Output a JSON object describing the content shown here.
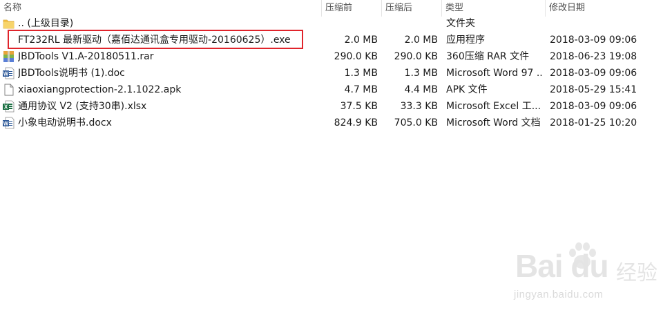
{
  "columns": {
    "name": "名称",
    "compressed": "压缩前",
    "original": "压缩后",
    "type": "类型",
    "modified": "修改日期"
  },
  "files": [
    {
      "icon": "folder-icon",
      "name": ".. (上级目录)",
      "compressed": "",
      "original": "",
      "type": "文件夹",
      "modified": ""
    },
    {
      "icon": "",
      "name": "FT232RL  最新驱动（嘉佰达通讯盒专用驱动-20160625）.exe",
      "compressed": "2.0 MB",
      "original": "2.0 MB",
      "type": "应用程序",
      "modified": "2018-03-09 09:06"
    },
    {
      "icon": "rar-archive-icon",
      "name": "JBDTools V1.A-20180511.rar",
      "compressed": "290.0 KB",
      "original": "290.0 KB",
      "type": "360压缩 RAR 文件",
      "modified": "2018-06-23 19:08"
    },
    {
      "icon": "word-doc-icon",
      "name": "JBDTools说明书 (1).doc",
      "compressed": "1.3 MB",
      "original": "1.3 MB",
      "type": "Microsoft Word 97 ...",
      "modified": "2018-03-09 09:06"
    },
    {
      "icon": "blank-file-icon",
      "name": "xiaoxiangprotection-2.1.1022.apk",
      "compressed": "4.7 MB",
      "original": "4.4 MB",
      "type": "APK 文件",
      "modified": "2018-05-29 15:41"
    },
    {
      "icon": "excel-icon",
      "name": "通用协议 V2 (支持30串).xlsx",
      "compressed": "37.5 KB",
      "original": "33.3 KB",
      "type": "Microsoft Excel 工...",
      "modified": "2018-03-09 09:06"
    },
    {
      "icon": "word-docx-icon",
      "name": "小象电动说明书.docx",
      "compressed": "824.9 KB",
      "original": "705.0 KB",
      "type": "Microsoft Word 文档",
      "modified": "2018-01-25 10:20"
    }
  ],
  "watermark": {
    "brand": "Bai du",
    "cn": "经验",
    "url": "jingyan.baidu.com"
  },
  "colors": {
    "highlight": "#e0242b",
    "folder": "#f3c24a",
    "word": "#2b5797",
    "excel": "#1e7145"
  }
}
